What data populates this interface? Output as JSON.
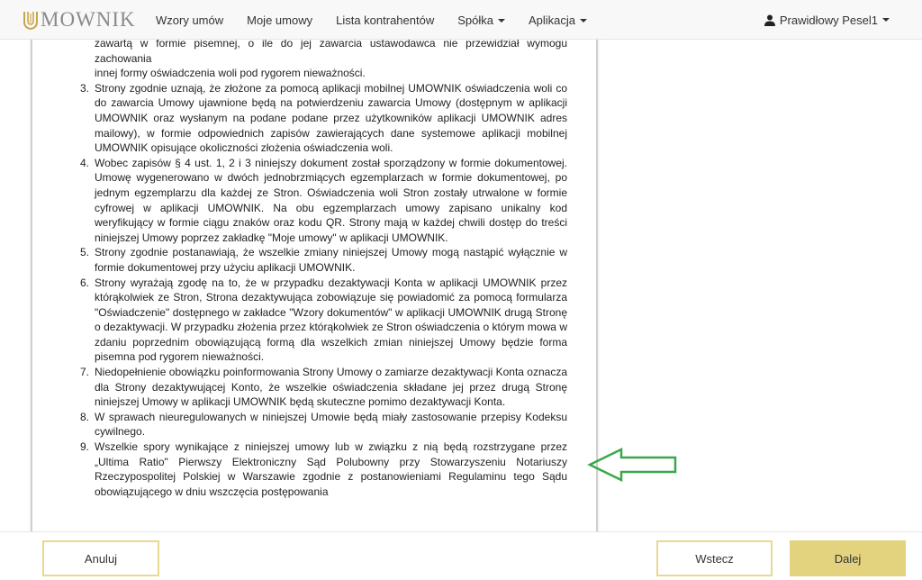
{
  "brand": {
    "logo_text": "MOWNIK",
    "logo_letter": "U"
  },
  "nav": {
    "items": [
      {
        "label": "Wzory umów"
      },
      {
        "label": "Moje umowy"
      },
      {
        "label": "Lista kontrahentów"
      },
      {
        "label": "Spółka",
        "dropdown": true
      },
      {
        "label": "Aplikacja",
        "dropdown": true
      }
    ],
    "user": {
      "label": "Prawidłowy Pesel1",
      "icon": "user-icon"
    }
  },
  "document": {
    "top_fragment": [
      "zawartą w formie pisemnej, o ile do jej zawarcia ustawodawca nie przewidział wymogu zachowania",
      "innej formy oświadczenia woli pod rygorem nieważności."
    ],
    "items": [
      {
        "num": "3.",
        "text": "Strony zgodnie uznają, że złożone za pomocą aplikacji mobilnej UMOWNIK oświadczenia woli co do zawarcia Umowy ujawnione będą na potwierdzeniu zawarcia Umowy (dostępnym w aplikacji UMOWNIK oraz wysłanym na podane podane przez użytkowników aplikacji UMOWNIK adres mailowy), w formie odpowiednich zapisów zawierających dane systemowe aplikacji mobilnej UMOWNIK opisujące okoliczności złożenia oświadczenia woli."
      },
      {
        "num": "4.",
        "text": "Wobec zapisów § 4 ust. 1, 2 i 3 niniejszy dokument został sporządzony w formie dokumentowej. Umowę wygenerowano w dwóch jednobrzmiących egzemplarzach w formie dokumentowej, po jednym egzemplarzu dla każdej ze Stron. Oświadczenia woli Stron zostały utrwalone w formie cyfrowej w aplikacji UMOWNIK. Na obu egzemplarzach umowy zapisano unikalny kod weryfikujący w formie ciągu znaków oraz kodu QR. Strony mają w każdej chwili dostęp do treści niniejszej Umowy poprzez zakładkę \"Moje umowy\" w aplikacji UMOWNIK."
      },
      {
        "num": "5.",
        "text": "Strony zgodnie postanawiają, że wszelkie zmiany niniejszej Umowy mogą nastąpić wyłącznie w formie dokumentowej przy użyciu aplikacji UMOWNIK."
      },
      {
        "num": "6.",
        "text": "Strony wyrażają zgodę na to, że w przypadku dezaktywacji Konta w aplikacji UMOWNIK przez którąkolwiek ze Stron, Strona dezaktywująca zobowiązuje się powiadomić za pomocą formularza \"Oświadczenie\" dostępnego w zakładce \"Wzory dokumentów\" w aplikacji UMOWNIK drugą Stronę o dezaktywacji. W przypadku złożenia przez którąkolwiek ze Stron oświadczenia o którym mowa w zdaniu poprzednim obowiązującą formą dla wszelkich zmian niniejszej Umowy będzie forma pisemna pod rygorem nieważności."
      },
      {
        "num": "7.",
        "text": "Niedopełnienie obowiązku poinformowania Strony Umowy o zamiarze dezaktywacji Konta oznacza dla Strony dezaktywującej Konto, że wszelkie oświadczenia składane jej przez drugą Stronę niniejszej Umowy w aplikacji UMOWNIK będą skuteczne pomimo dezaktywacji Konta."
      },
      {
        "num": "8.",
        "text": "W sprawach nieuregulowanych w niniejszej Umowie będą miały zastosowanie przepisy Kodeksu cywilnego."
      },
      {
        "num": "9.",
        "text": "Wszelkie spory wynikające z niniejszej umowy lub w związku z nią będą rozstrzygane przez „Ultima Ratio\" Pierwszy Elektroniczny Sąd Polubowny przy Stowarzyszeniu Notariuszy Rzeczypospolitej Polskiej w Warszawie zgodnie z postanowieniami Regulaminu tego Sądu obowiązującego w dniu wszczęcia postępowania"
      }
    ]
  },
  "annotation": {
    "icon": "arrow-left-icon",
    "color": "#3aa84a"
  },
  "footer": {
    "cancel_label": "Anuluj",
    "back_label": "Wstecz",
    "next_label": "Dalej"
  },
  "colors": {
    "accent": "#e3d37f",
    "accent_border": "#e8d991",
    "brand_gold": "#c9a64a"
  }
}
